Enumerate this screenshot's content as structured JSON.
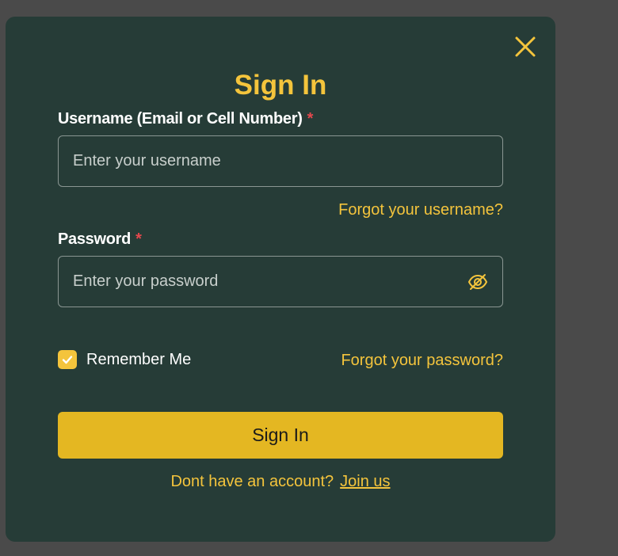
{
  "modal": {
    "title": "Sign In",
    "close_icon": "close-icon"
  },
  "username": {
    "label": "Username (Email or Cell Number)",
    "required_mark": "*",
    "placeholder": "Enter your username",
    "value": "",
    "forgot_link": "Forgot your username?"
  },
  "password": {
    "label": "Password",
    "required_mark": "*",
    "placeholder": "Enter your password",
    "value": "",
    "toggle_icon": "eye-off-icon"
  },
  "remember": {
    "label": "Remember Me",
    "checked": true
  },
  "forgot_password_link": "Forgot your password?",
  "submit_label": "Sign In",
  "footer": {
    "prompt": "Dont have an account?",
    "join_link": "Join us"
  },
  "colors": {
    "backdrop": "#4a4a4a",
    "modal_bg": "#263c37",
    "accent": "#f4c43c",
    "button": "#e4b722",
    "required": "#e5484d"
  }
}
